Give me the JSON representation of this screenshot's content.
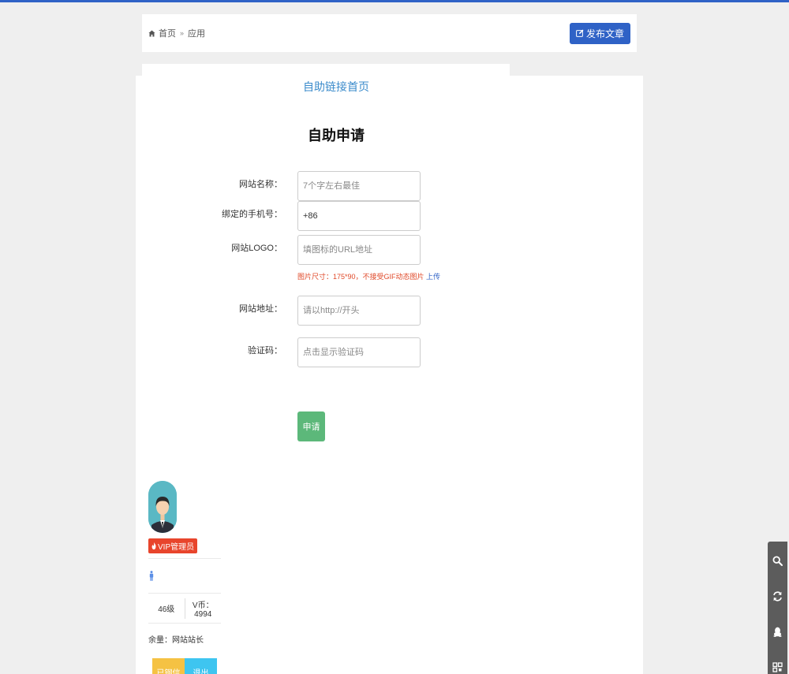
{
  "breadcrumb": {
    "home": "首页",
    "separator": "»",
    "current": "应用"
  },
  "header": {
    "publish_label": "发布文章"
  },
  "main": {
    "link_home": "自助链接首页",
    "title": "自助申请"
  },
  "form": {
    "site_name": {
      "label": "网站名称：",
      "placeholder": "7个字左右最佳"
    },
    "phone": {
      "label": "绑定的手机号：",
      "value": "+86"
    },
    "logo": {
      "label": "网站LOGO：",
      "placeholder": "填图标的URL地址"
    },
    "logo_hint": "图片尺寸：175*90，不接受GIF动态图片",
    "upload_label": "上传",
    "site_url": {
      "label": "网站地址：",
      "placeholder": "请以http://开头"
    },
    "captcha": {
      "label": "验证码：",
      "placeholder": "点击显示验证码"
    },
    "submit_label": "申请"
  },
  "user": {
    "role": "VIP管理员",
    "level": "46级",
    "coins": "V币：4994",
    "balance": "余量：网站站长",
    "info_label": "已钢信",
    "logout_label": "退出"
  },
  "colors": {
    "accent": "#2f62c6",
    "link": "#3b8bcb",
    "submit": "#5cb87a",
    "badge": "#e8452c",
    "hint": "#e04a2a",
    "toolbar": "#5c5c5c"
  },
  "icons": [
    "home-icon",
    "edit-icon",
    "flame-icon",
    "person-icon",
    "search-icon",
    "refresh-icon",
    "qq-icon",
    "qrcode-icon"
  ]
}
